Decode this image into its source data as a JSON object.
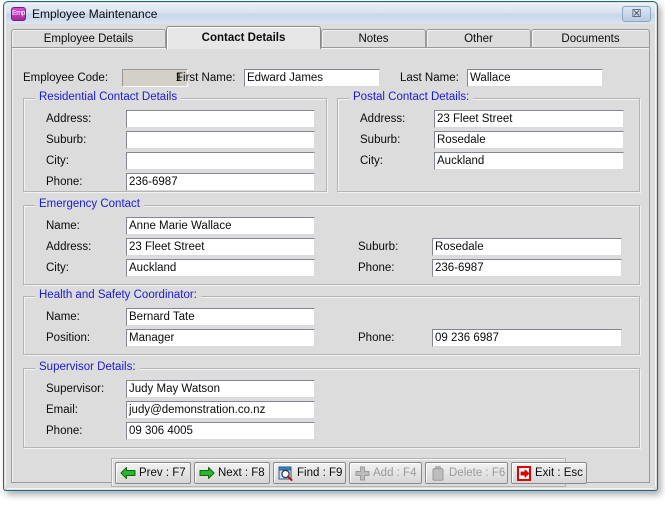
{
  "window": {
    "title": "Employee Maintenance",
    "icon": "app-icon",
    "close_label": "☒"
  },
  "tabs": [
    {
      "label": "Employee Details",
      "selected": false
    },
    {
      "label": "Contact Details",
      "selected": true
    },
    {
      "label": "Notes",
      "selected": false
    },
    {
      "label": "Other",
      "selected": false
    },
    {
      "label": "Documents",
      "selected": false
    }
  ],
  "header": {
    "employee_code_label": "Employee Code:",
    "employee_code_value": "1",
    "first_name_label": "First Name:",
    "first_name_value": "Edward James",
    "last_name_label": "Last Name:",
    "last_name_value": "Wallace"
  },
  "residential": {
    "title": "Residential Contact Details",
    "address_label": "Address:",
    "address_value": "",
    "suburb_label": "Suburb:",
    "suburb_value": "",
    "city_label": "City:",
    "city_value": "",
    "phone_label": "Phone:",
    "phone_value": "236-6987"
  },
  "postal": {
    "title": "Postal Contact Details:",
    "address_label": "Address:",
    "address_value": "23 Fleet Street",
    "suburb_label": "Suburb:",
    "suburb_value": "Rosedale",
    "city_label": "City:",
    "city_value": "Auckland"
  },
  "emergency": {
    "title": "Emergency Contact",
    "name_label": "Name:",
    "name_value": "Anne Marie Wallace",
    "address_label": "Address:",
    "address_value": "23 Fleet Street",
    "city_label": "City:",
    "city_value": "Auckland",
    "suburb_label": "Suburb:",
    "suburb_value": "Rosedale",
    "phone_label": "Phone:",
    "phone_value": "236-6987"
  },
  "health_safety": {
    "title": "Health and Safety Coordinator:",
    "name_label": "Name:",
    "name_value": "Bernard Tate",
    "position_label": "Position:",
    "position_value": "Manager",
    "phone_label": "Phone:",
    "phone_value": "09 236 6987"
  },
  "supervisor": {
    "title": "Supervisor Details:",
    "supervisor_label": "Supervisor:",
    "supervisor_value": "Judy May Watson",
    "email_label": "Email:",
    "email_value": "judy@demonstration.co.nz",
    "phone_label": "Phone:",
    "phone_value": "09 306 4005"
  },
  "buttons": [
    {
      "label": "Prev : F7",
      "icon": "arrow-left-green-icon",
      "enabled": true
    },
    {
      "label": "Next : F8",
      "icon": "arrow-right-green-icon",
      "enabled": true
    },
    {
      "label": "Find : F9",
      "icon": "magnifier-icon",
      "enabled": true
    },
    {
      "label": "Add : F4",
      "icon": "plus-icon",
      "enabled": false
    },
    {
      "label": "Delete : F6",
      "icon": "trash-icon",
      "enabled": false
    },
    {
      "label": "Exit : Esc",
      "icon": "exit-door-icon",
      "enabled": true
    }
  ],
  "colors": {
    "group_title": "#1a1ad6",
    "window_border": "#1c6d86",
    "face": "#dcdcdc",
    "green_arrow": "#16a016",
    "red_exit": "#e00000"
  }
}
